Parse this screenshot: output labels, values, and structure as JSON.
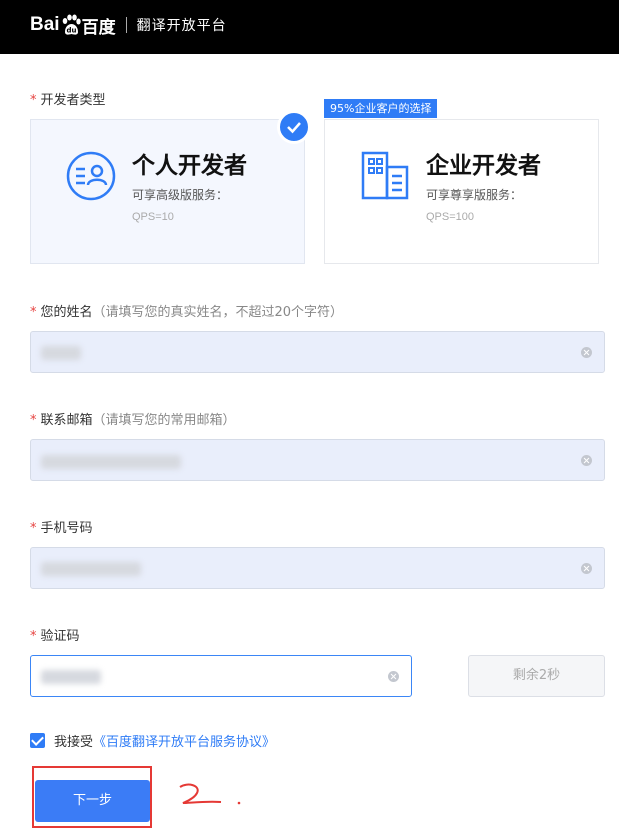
{
  "header": {
    "brand": "Bai",
    "brand_cn": "百度",
    "product": "翻译开放平台"
  },
  "developer_type": {
    "label": "开发者类型",
    "badge": "95%企业客户的选择",
    "cards": [
      {
        "title": "个人开发者",
        "desc": "可享高级版服务：",
        "qps": "QPS=10",
        "selected": true
      },
      {
        "title": "企业开发者",
        "desc": "可享尊享版服务：",
        "qps": "QPS=100",
        "selected": false
      }
    ]
  },
  "name_field": {
    "label": "您的姓名",
    "hint": "（请填写您的真实姓名，不超过20个字符）",
    "value": ""
  },
  "email_field": {
    "label": "联系邮箱",
    "hint": "（请填写您的常用邮箱）",
    "value": ""
  },
  "phone_field": {
    "label": "手机号码",
    "value": ""
  },
  "code_field": {
    "label": "验证码",
    "value": ""
  },
  "countdown_button": "剩余2秒",
  "agreement": {
    "text": "我接受",
    "link": "《百度翻译开放平台服务协议》",
    "checked": true
  },
  "next_button": "下一步",
  "colors": {
    "accent": "#2f7cf6",
    "required": "#e64340",
    "annotation": "#e53935"
  }
}
